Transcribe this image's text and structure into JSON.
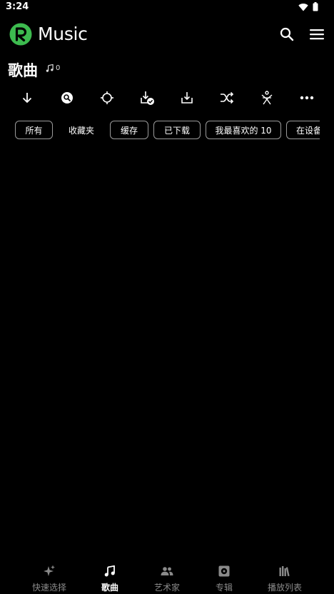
{
  "status_bar": {
    "time": "3:24"
  },
  "app_bar": {
    "title": "Music"
  },
  "header": {
    "title": "歌曲",
    "count": "0"
  },
  "toolbar": {
    "items": [
      {
        "name": "sort-down-icon"
      },
      {
        "name": "search-circle-icon"
      },
      {
        "name": "locate-icon"
      },
      {
        "name": "downloaded-check-icon"
      },
      {
        "name": "download-icon"
      },
      {
        "name": "shuffle-icon"
      },
      {
        "name": "dj-icon"
      },
      {
        "name": "more-icon"
      }
    ]
  },
  "chips": {
    "items": [
      {
        "label": "所有"
      },
      {
        "label": "收藏夹"
      },
      {
        "label": "缓存"
      },
      {
        "label": "已下载"
      },
      {
        "label": "我最喜欢的 10"
      },
      {
        "label": "在设备"
      }
    ]
  },
  "bottom_nav": {
    "items": [
      {
        "label": "快速选择",
        "icon": "sparkle-icon"
      },
      {
        "label": "歌曲",
        "icon": "music-note-icon"
      },
      {
        "label": "艺术家",
        "icon": "people-icon"
      },
      {
        "label": "专辑",
        "icon": "album-icon"
      },
      {
        "label": "播放列表",
        "icon": "library-icon"
      }
    ],
    "active_index": 1
  },
  "colors": {
    "background": "#000000",
    "accent": "#3dbb4f",
    "muted": "#8a8a8a"
  }
}
